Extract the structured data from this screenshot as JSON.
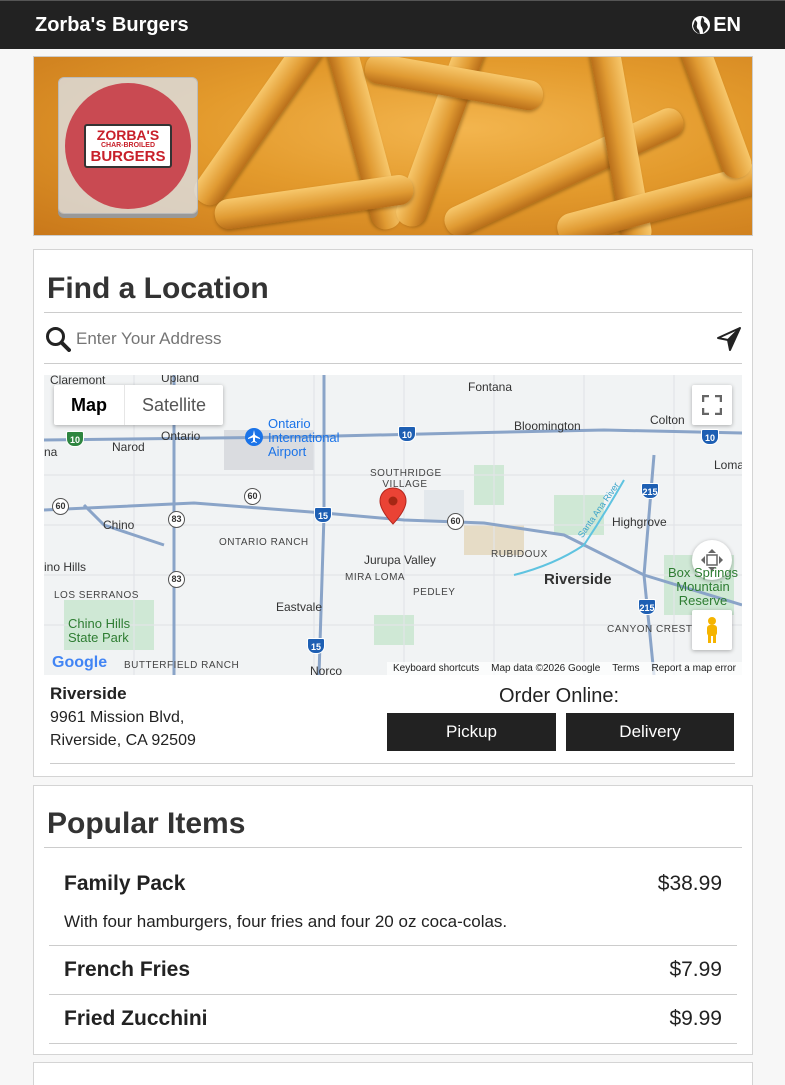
{
  "header": {
    "brand": "Zorba's Burgers",
    "lang": "EN"
  },
  "hero": {
    "logo_line1": "ZORBA'S",
    "logo_line2": "CHAR-BROILED",
    "logo_line3": "BURGERS"
  },
  "find_location": {
    "title": "Find a Location",
    "search_placeholder": "Enter Your Address",
    "map": {
      "tab_map": "Map",
      "tab_satellite": "Satellite",
      "labels": {
        "claremont": "Claremont",
        "upland": "Upland",
        "fontana": "Fontana",
        "ontario": "Ontario",
        "ontario_airport": "Ontario International Airport",
        "bloomington": "Bloomington",
        "colton": "Colton",
        "narod": "Narod",
        "loma": "Loma",
        "southridge": "SOUTHRIDGE VILLAGE",
        "chino": "Chino",
        "ontario_ranch": "ONTARIO RANCH",
        "highgrove": "Highgrove",
        "rubidoux": "RUBIDOUX",
        "jurupa": "Jurupa Valley",
        "mira_loma": "MIRA LOMA",
        "riverside": "Riverside",
        "chino_hills": "ino Hills",
        "los_serranos": "LOS SERRANOS",
        "pedley": "PEDLEY",
        "eastvale": "Eastvale",
        "box_springs": "Box Springs Mountain Reserve",
        "chino_hills_park": "Chino Hills State Park",
        "canyon_crest": "CANYON CREST",
        "butterfield": "BUTTERFIELD RANCH",
        "norco": "Norco",
        "santa_ana_river": "Santa Ana River",
        "na": "na"
      },
      "footer": {
        "shortcuts": "Keyboard shortcuts",
        "data": "Map data ©2026 Google",
        "terms": "Terms",
        "report": "Report a map error"
      },
      "google": "Google"
    },
    "location": {
      "name": "Riverside",
      "address1": "9961 Mission Blvd,",
      "address2": "Riverside, CA 92509"
    },
    "order": {
      "label": "Order Online:",
      "pickup": "Pickup",
      "delivery": "Delivery"
    }
  },
  "popular": {
    "title": "Popular Items",
    "items": [
      {
        "name": "Family Pack",
        "price": "$38.99",
        "desc": "With four hamburgers, four fries and four 20 oz coca-colas."
      },
      {
        "name": "French Fries",
        "price": "$7.99"
      },
      {
        "name": "Fried Zucchini",
        "price": "$9.99"
      }
    ]
  }
}
